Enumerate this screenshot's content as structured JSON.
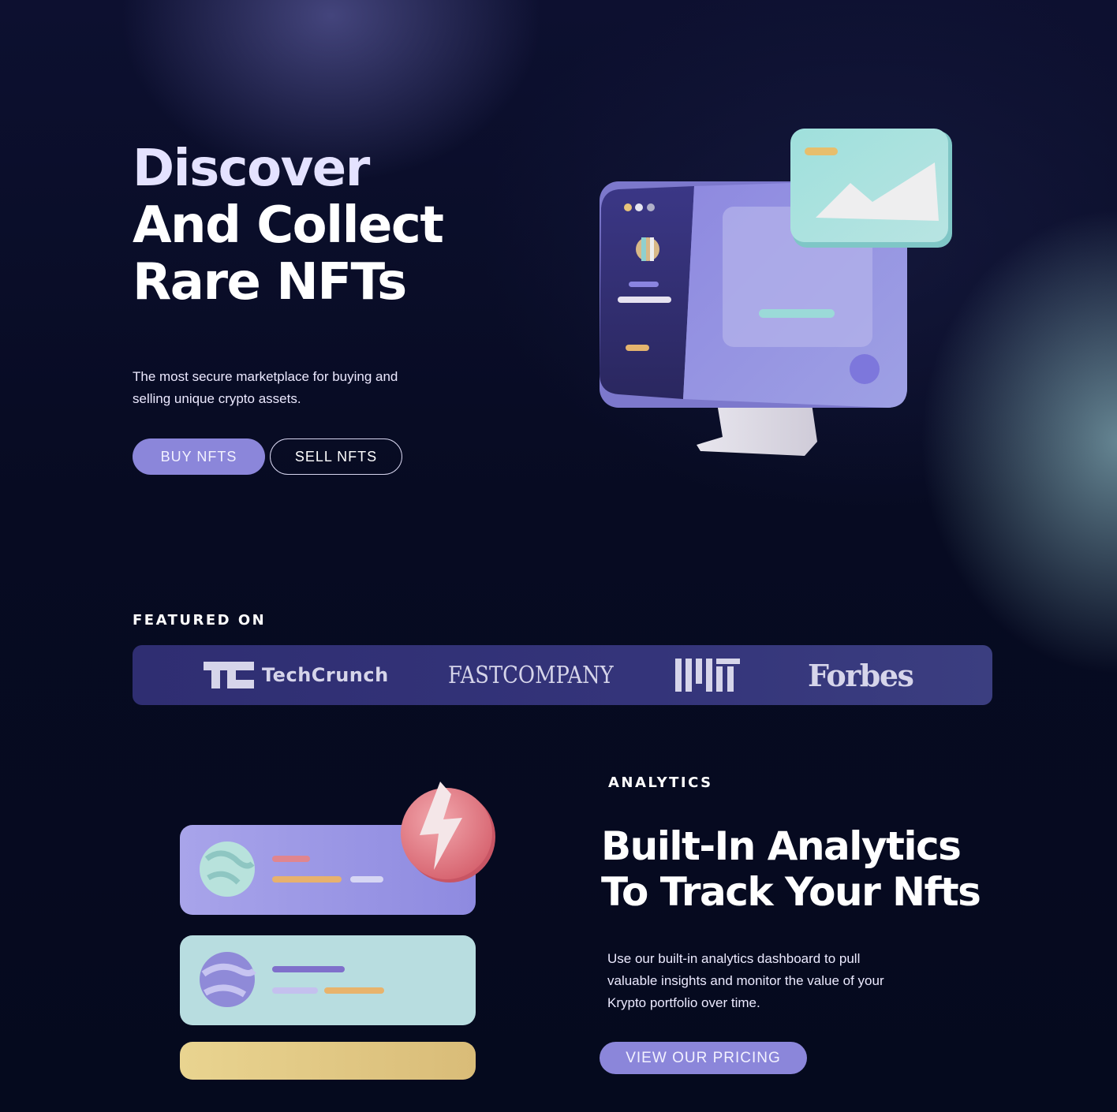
{
  "hero": {
    "title_line1": "Discover",
    "title_line2": "And Collect",
    "title_line3": "Rare NFTs",
    "subtitle": "The most secure marketplace for buying and selling unique crypto assets.",
    "buy_label": "BUY NFTS",
    "sell_label": "SELL NFTS",
    "illustration_icon": "monitor-icon"
  },
  "featured": {
    "label": "FEATURED ON",
    "logos": [
      {
        "name": "TechCrunch",
        "icon": "techcrunch-logo"
      },
      {
        "name": "FASTCOMPANY",
        "icon": "fastcompany-logo"
      },
      {
        "name": "MIT",
        "icon": "mit-logo"
      },
      {
        "name": "Forbes",
        "icon": "forbes-logo"
      }
    ]
  },
  "analytics": {
    "label": "ANALYTICS",
    "title_line1": "Built-In Analytics",
    "title_line2": "To Track Your Nfts",
    "description": "Use our built-in analytics dashboard to pull valuable insights and monitor the value of your Krypto portfolio over time.",
    "pricing_label": "VIEW OUR PRICING",
    "illustration_icon": "lightning-icon"
  },
  "colors": {
    "background": "#060a20",
    "accent": "#8b86da",
    "logo_bar": "#2f2e72",
    "teal": "#aee0e0",
    "gold": "#e0c47e",
    "coral": "#e8808a"
  }
}
